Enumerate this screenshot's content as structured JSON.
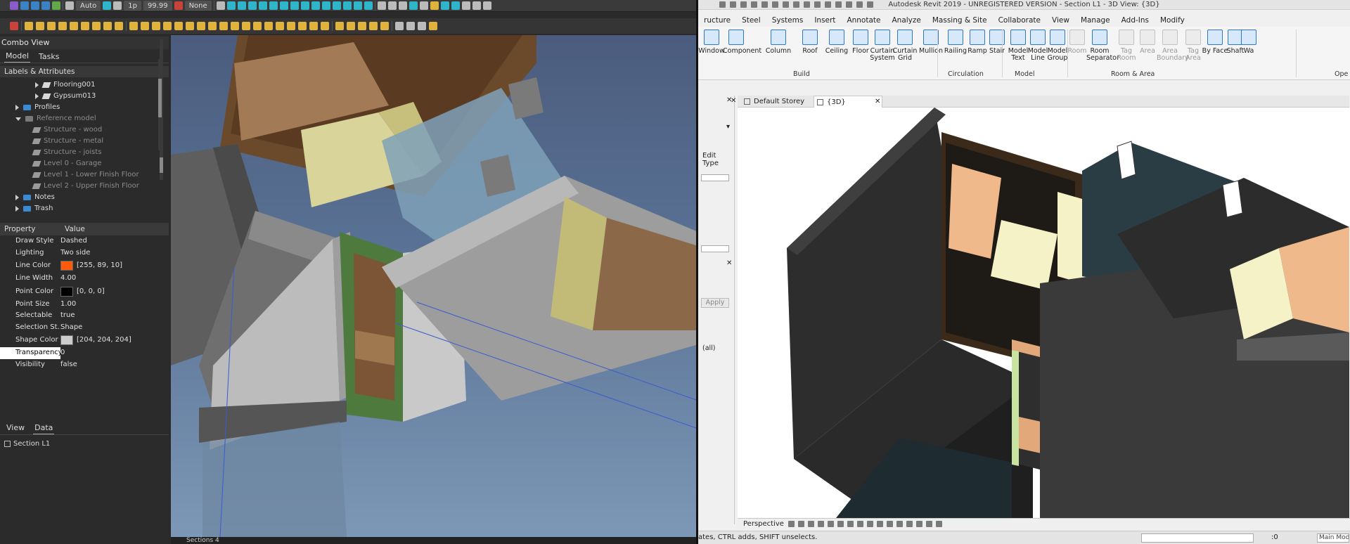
{
  "left": {
    "toolbar": {
      "draw_mode": "Auto",
      "line_width": "1p",
      "zoom_value": "99.99",
      "snap_none": "None"
    },
    "combo_view_title": "Combo View",
    "tabs": [
      "Model",
      "Tasks"
    ],
    "labels_header": "Labels & Attributes",
    "tree": [
      {
        "label": "Flooring001",
        "kind": "layer",
        "indent": 3,
        "arrow": "right",
        "dim": false
      },
      {
        "label": "Gypsum013",
        "kind": "layer",
        "indent": 3,
        "arrow": "right",
        "dim": false
      },
      {
        "label": "Profiles",
        "kind": "folder",
        "indent": 1,
        "arrow": "right",
        "dim": false
      },
      {
        "label": "Reference model",
        "kind": "folder-grey",
        "indent": 1,
        "arrow": "down",
        "dim": true
      },
      {
        "label": "Structure - wood",
        "kind": "layer-grey",
        "indent": 2,
        "arrow": "none",
        "dim": true
      },
      {
        "label": "Structure - metal",
        "kind": "layer-grey",
        "indent": 2,
        "arrow": "none",
        "dim": true
      },
      {
        "label": "Structure - joists",
        "kind": "layer-grey",
        "indent": 2,
        "arrow": "none",
        "dim": true
      },
      {
        "label": "Level 0 - Garage",
        "kind": "layer-grey",
        "indent": 2,
        "arrow": "none",
        "dim": true
      },
      {
        "label": "Level 1 - Lower Finish Floor",
        "kind": "layer-grey",
        "indent": 2,
        "arrow": "none",
        "dim": true
      },
      {
        "label": "Level 2 - Upper Finish Floor",
        "kind": "layer-grey",
        "indent": 2,
        "arrow": "none",
        "dim": true
      },
      {
        "label": "Notes",
        "kind": "folder",
        "indent": 1,
        "arrow": "right",
        "dim": false
      },
      {
        "label": "Trash",
        "kind": "folder",
        "indent": 1,
        "arrow": "right",
        "dim": false
      }
    ],
    "property_header": {
      "property": "Property",
      "value": "Value"
    },
    "properties": [
      {
        "key": "Draw Style",
        "value": "Dashed",
        "swatch": null,
        "selected": false
      },
      {
        "key": "Lighting",
        "value": "Two side",
        "swatch": null,
        "selected": false
      },
      {
        "key": "Line Color",
        "value": "[255, 89, 10]",
        "swatch": "#ff590a",
        "selected": false
      },
      {
        "key": "Line Width",
        "value": "4.00",
        "swatch": null,
        "selected": false
      },
      {
        "key": "Point Color",
        "value": "[0, 0, 0]",
        "swatch": "#000000",
        "selected": false
      },
      {
        "key": "Point Size",
        "value": "1.00",
        "swatch": null,
        "selected": false
      },
      {
        "key": "Selectable",
        "value": "true",
        "swatch": null,
        "selected": false
      },
      {
        "key": "Selection St...",
        "value": "Shape",
        "swatch": null,
        "selected": false
      },
      {
        "key": "Shape Color",
        "value": "[204, 204, 204]",
        "swatch": "#cccccc",
        "selected": false
      },
      {
        "key": "Transparency",
        "value": "0",
        "swatch": null,
        "selected": true
      },
      {
        "key": "Visibility",
        "value": "false",
        "swatch": null,
        "selected": false
      }
    ],
    "bottom_tabs": [
      "View",
      "Data"
    ],
    "section_item": "Section L1",
    "viewport_footer": "Sections 4"
  },
  "right": {
    "title": "Autodesk Revit 2019 - UNREGISTERED VERSION - Section L1 - 3D View: {3D}",
    "menus": [
      "ructure",
      "Steel",
      "Systems",
      "Insert",
      "Annotate",
      "Analyze",
      "Massing & Site",
      "Collaborate",
      "View",
      "Manage",
      "Add-Ins",
      "Modify"
    ],
    "ribbon_tools": [
      {
        "label": "Window",
        "disabled": false
      },
      {
        "label": "Component",
        "disabled": false
      },
      {
        "label": "Column",
        "disabled": false
      },
      {
        "label": "Roof",
        "disabled": false
      },
      {
        "label": "Ceiling",
        "disabled": false
      },
      {
        "label": "Floor",
        "disabled": false
      },
      {
        "label": "Curtain System",
        "disabled": false
      },
      {
        "label": "Curtain Grid",
        "disabled": false
      },
      {
        "label": "Mullion",
        "disabled": false
      },
      {
        "label": "Railing",
        "disabled": false
      },
      {
        "label": "Ramp",
        "disabled": false
      },
      {
        "label": "Stair",
        "disabled": false
      },
      {
        "label": "Model Text",
        "disabled": false
      },
      {
        "label": "Model Line",
        "disabled": false
      },
      {
        "label": "Model Group",
        "disabled": false
      },
      {
        "label": "Room",
        "disabled": true
      },
      {
        "label": "Room Separator",
        "disabled": false
      },
      {
        "label": "Tag Room",
        "disabled": true
      },
      {
        "label": "Area",
        "disabled": true
      },
      {
        "label": "Area Boundary",
        "disabled": true
      },
      {
        "label": "Tag Area",
        "disabled": true
      },
      {
        "label": "By Face",
        "disabled": false
      },
      {
        "label": "Shaft",
        "disabled": false
      },
      {
        "label": "Wa",
        "disabled": false
      }
    ],
    "ribbon_groups": [
      "Build",
      "Circulation",
      "Model",
      "Room & Area",
      "Ope"
    ],
    "edit_type": "Edit Type",
    "apply": "Apply",
    "all_label": "(all)",
    "view_tabs": [
      "Default Storey",
      "{3D}"
    ],
    "view_mode": "Perspective",
    "status_text": "ates, CTRL adds, SHIFT unselects.",
    "status_zero": ":0",
    "main_model": "Main Model"
  },
  "colors": {
    "revit_accent": "#2f78c7",
    "freecad_bg_top": "#4b5c7e",
    "freecad_bg_bottom": "#7d97b6"
  }
}
